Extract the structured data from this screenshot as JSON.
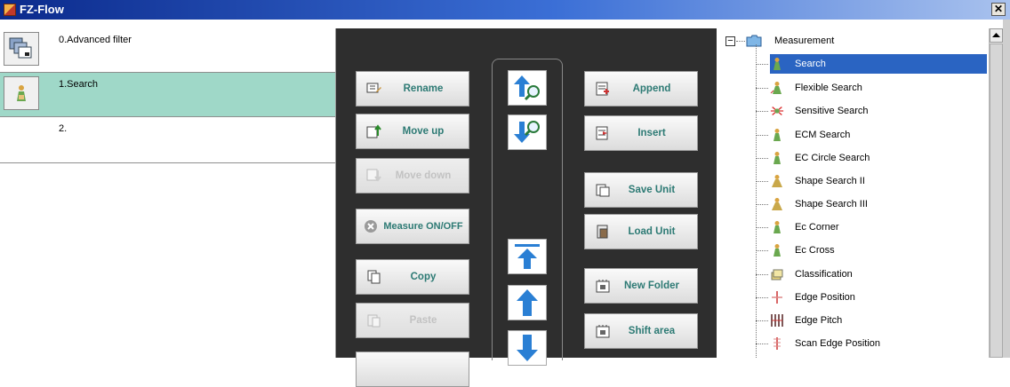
{
  "window": {
    "title": "FZ-Flow",
    "close_glyph": "✕"
  },
  "flow": {
    "rows": [
      {
        "label": "0.Advanced filter",
        "icon": "filter-stack-icon"
      },
      {
        "label": "1.Search",
        "icon": "search-figure-icon"
      },
      {
        "label": "2.",
        "icon": ""
      }
    ],
    "selected_index": 1
  },
  "tools": {
    "left_buttons": [
      {
        "label": "Rename",
        "icon": "rename-icon",
        "enabled": true
      },
      {
        "label": "Move up",
        "icon": "move-up-icon",
        "enabled": true
      },
      {
        "label": "Move down",
        "icon": "move-down-icon",
        "enabled": false
      },
      {
        "label": "Measure ON/OFF",
        "icon": "measure-toggle-icon",
        "enabled": true
      },
      {
        "label": "Copy",
        "icon": "copy-icon",
        "enabled": true
      },
      {
        "label": "Paste",
        "icon": "paste-icon",
        "enabled": false
      }
    ],
    "arrow_buttons": [
      {
        "icon": "arrow-up-search-icon"
      },
      {
        "icon": "arrow-down-search-icon"
      },
      {
        "icon": "arrow-to-top-icon"
      },
      {
        "icon": "arrow-up-icon"
      },
      {
        "icon": "arrow-down-icon"
      }
    ],
    "right_buttons": [
      {
        "label": "Append",
        "icon": "append-icon"
      },
      {
        "label": "Insert",
        "icon": "insert-icon"
      },
      {
        "label": "Save Unit",
        "icon": "save-unit-icon"
      },
      {
        "label": "Load Unit",
        "icon": "load-unit-icon"
      },
      {
        "label": "New Folder",
        "icon": "new-folder-icon"
      },
      {
        "label": "Shift area",
        "icon": "shift-area-icon"
      }
    ]
  },
  "tree": {
    "root_label": "Measurement",
    "expander": "−",
    "items": [
      {
        "label": "Search",
        "icon": "search-figure-icon",
        "selected": true
      },
      {
        "label": "Flexible Search",
        "icon": "flexible-search-icon"
      },
      {
        "label": "Sensitive Search",
        "icon": "sensitive-search-icon"
      },
      {
        "label": "ECM Search",
        "icon": "ecm-search-icon"
      },
      {
        "label": "EC Circle Search",
        "icon": "ec-circle-search-icon"
      },
      {
        "label": "Shape Search II",
        "icon": "shape-search-icon"
      },
      {
        "label": "Shape Search III",
        "icon": "shape-search-icon"
      },
      {
        "label": "Ec Corner",
        "icon": "ec-corner-icon"
      },
      {
        "label": "Ec Cross",
        "icon": "ec-cross-icon"
      },
      {
        "label": "Classification",
        "icon": "classification-icon"
      },
      {
        "label": "Edge Position",
        "icon": "edge-position-icon"
      },
      {
        "label": "Edge Pitch",
        "icon": "edge-pitch-icon"
      },
      {
        "label": "Scan Edge Position",
        "icon": "scan-edge-position-icon"
      }
    ]
  }
}
